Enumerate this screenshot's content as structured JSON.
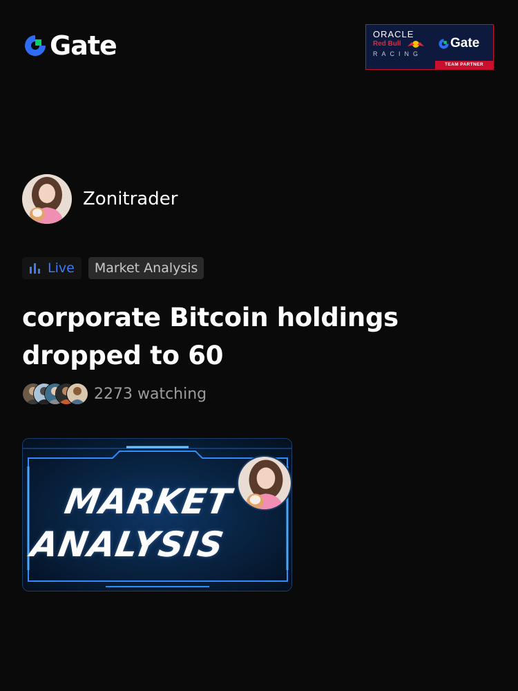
{
  "header": {
    "logo_text": "Gate",
    "partner": {
      "oracle": "ORACLE",
      "red_bull": "Red Bull",
      "racing": "RACING",
      "gate": "Gate",
      "badge": "TEAM PARTNER"
    }
  },
  "author": {
    "name": "Zonitrader",
    "avatar_icon": "user-avatar"
  },
  "tags": {
    "live": "Live",
    "live_icon": "bars-chart-icon",
    "category": "Market Analysis"
  },
  "title": "corporate Bitcoin holdings dropped to 60",
  "watchers": {
    "count_text": "2273 watching"
  },
  "thumbnail": {
    "line1": "MARKET",
    "line2": "ANALYSIS"
  },
  "colors": {
    "accent_blue": "#3e7bf5",
    "background": "#0a0a0a",
    "logo_green": "#00d26a",
    "partner_red": "#c8102e"
  }
}
